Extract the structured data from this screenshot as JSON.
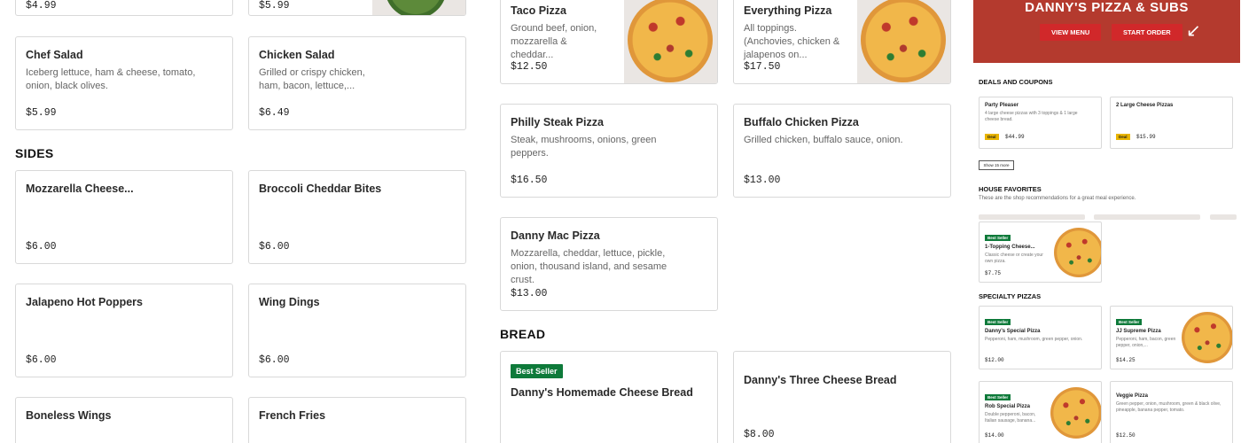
{
  "col1": {
    "top_prices": [
      "$4.99",
      "$5.99"
    ],
    "items": [
      {
        "name": "Chef Salad",
        "desc": "Iceberg lettuce, ham & cheese, tomato, onion, black olives.",
        "price": "$5.99"
      },
      {
        "name": "Chicken Salad",
        "desc": "Grilled or crispy chicken, ham, bacon, lettuce,...",
        "price": "$6.49"
      }
    ],
    "sides_heading": "SIDES",
    "sides": [
      {
        "name": "Mozzarella Cheese...",
        "price": "$6.00"
      },
      {
        "name": "Broccoli Cheddar Bites",
        "price": "$6.00"
      },
      {
        "name": "Jalapeno Hot Poppers",
        "price": "$6.00"
      },
      {
        "name": "Wing Dings",
        "price": "$6.00"
      },
      {
        "name": "Boneless Wings",
        "price": ""
      },
      {
        "name": "French Fries",
        "price": ""
      }
    ]
  },
  "col2": {
    "items": [
      {
        "name": "Taco Pizza",
        "desc": "Ground beef, onion, mozzarella & cheddar...",
        "price": "$12.50"
      },
      {
        "name": "Everything Pizza",
        "desc": "All toppings. (Anchovies, chicken & jalapenos on...",
        "price": "$17.50"
      },
      {
        "name": "Philly Steak Pizza",
        "desc": "Steak, mushrooms, onions, green peppers.",
        "price": "$16.50"
      },
      {
        "name": "Buffalo Chicken Pizza",
        "desc": "Grilled chicken, buffalo sauce, onion.",
        "price": "$13.00"
      },
      {
        "name": "Danny Mac Pizza",
        "desc": "Mozzarella, cheddar, lettuce, pickle, onion, thousand island, and sesame crust.",
        "price": "$13.00"
      }
    ],
    "bread_heading": "BREAD",
    "bread": [
      {
        "badge": "Best Seller",
        "name": "Danny's Homemade Cheese Bread",
        "price": ""
      },
      {
        "name": "Danny's Three Cheese Bread",
        "price": "$8.00"
      }
    ]
  },
  "panel": {
    "brand": "DANNY'S PIZZA & SUBS",
    "view_menu": "VIEW MENU",
    "start_order": "START ORDER",
    "deals_heading": "DEALS AND COUPONS",
    "deals": [
      {
        "name": "Party Pleaser",
        "desc": "4 large cheese pizzas with 3 toppings & 1 large cheese bread.",
        "badge": "Deal",
        "price": "$44.99"
      },
      {
        "name": "2 Large Cheese Pizzas",
        "desc": "",
        "badge": "Deal",
        "price": "$15.99"
      }
    ],
    "show_more": "Show 15 more",
    "favorites_heading": "HOUSE FAVORITES",
    "favorites_sub": "These are the shop recommendations for a great meal experience.",
    "favorite": {
      "badge": "Best Seller",
      "name": "1-Topping Cheese...",
      "desc": "Classic cheese or create your own pizza.",
      "price": "$7.75"
    },
    "specialty_heading": "SPECIALTY PIZZAS",
    "specialty": [
      {
        "badge": "Best Seller",
        "name": "Danny's Special Pizza",
        "desc": "Pepperoni, ham, mushroom, green pepper, onion.",
        "price": "$12.00"
      },
      {
        "badge": "Best Seller",
        "name": "JJ Supreme Pizza",
        "desc": "Pepperoni, ham, bacon, green pepper, onion,...",
        "price": "$14.25"
      },
      {
        "badge": "Best Seller",
        "name": "Rob Special Pizza",
        "desc": "Double pepperoni, bacon, Italian sausage, banana...",
        "price": "$14.00"
      },
      {
        "badge": "",
        "name": "Veggie Pizza",
        "desc": "Green pepper, onion, mushroom, green & black olive, pineapple, banana pepper, tomato.",
        "price": "$12.50"
      }
    ]
  }
}
